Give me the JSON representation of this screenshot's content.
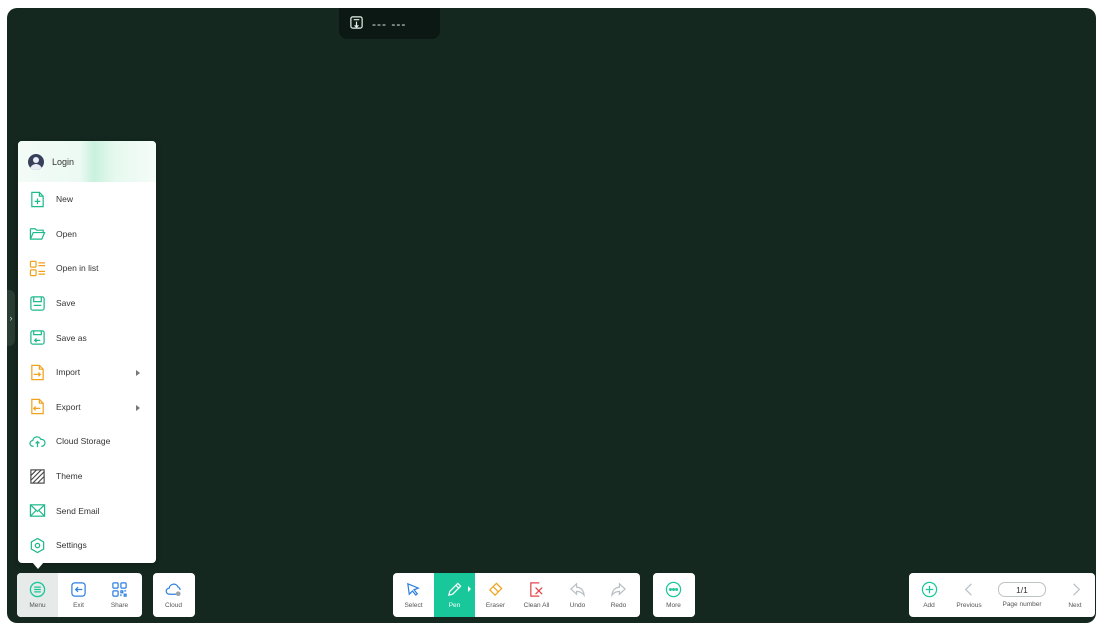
{
  "topbar": {
    "title": "--- ---"
  },
  "side_handle": {
    "glyph": "›"
  },
  "menu": {
    "login_label": "Login",
    "items": [
      {
        "label": "New",
        "icon": "new-file-icon",
        "has_submenu": false
      },
      {
        "label": "Open",
        "icon": "folder-open-icon",
        "has_submenu": false
      },
      {
        "label": "Open in list",
        "icon": "list-view-icon",
        "has_submenu": false
      },
      {
        "label": "Save",
        "icon": "save-icon",
        "has_submenu": false
      },
      {
        "label": "Save as",
        "icon": "save-as-icon",
        "has_submenu": false
      },
      {
        "label": "Import",
        "icon": "import-icon",
        "has_submenu": true
      },
      {
        "label": "Export",
        "icon": "export-icon",
        "has_submenu": true
      },
      {
        "label": "Cloud Storage",
        "icon": "cloud-storage-icon",
        "has_submenu": false
      },
      {
        "label": "Theme",
        "icon": "theme-icon",
        "has_submenu": false
      },
      {
        "label": "Send Email",
        "icon": "email-icon",
        "has_submenu": false
      },
      {
        "label": "Settings",
        "icon": "settings-icon",
        "has_submenu": false
      }
    ]
  },
  "toolbar_left": {
    "menu": "Menu",
    "exit": "Exit",
    "share": "Share"
  },
  "toolbar_cloud": {
    "cloud": "Cloud"
  },
  "toolbar_tools": {
    "select": "Select",
    "pen": "Pen",
    "eraser": "Eraser",
    "clean_all": "Clean All",
    "undo": "Undo",
    "redo": "Redo"
  },
  "toolbar_more": {
    "more": "More"
  },
  "toolbar_page": {
    "add": "Add",
    "previous": "Previous",
    "page_value": "1/1",
    "page_number": "Page number",
    "next": "Next"
  },
  "colors": {
    "board": "#14281f",
    "accent": "#18c79a",
    "icon_green": "#1fb98c",
    "icon_orange": "#f0a21c",
    "icon_red": "#e0444c",
    "icon_blue": "#2d7fe0"
  }
}
